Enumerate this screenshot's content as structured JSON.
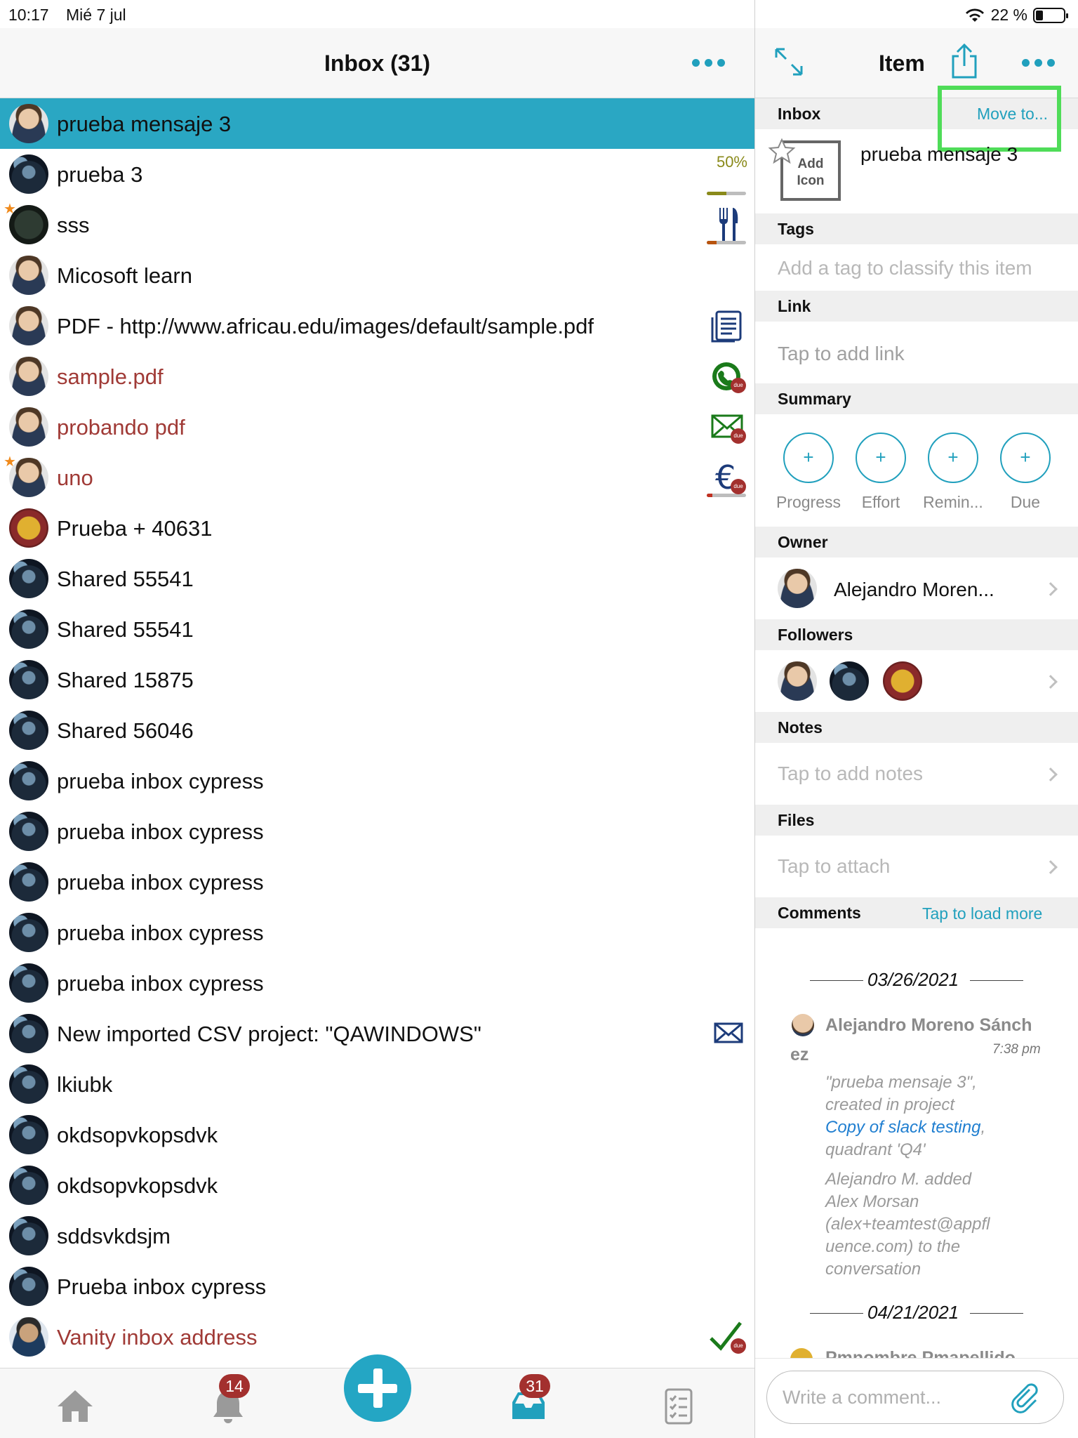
{
  "status": {
    "time": "10:17",
    "date": "Mié 7 jul",
    "battery": "22 %"
  },
  "list": {
    "title": "Inbox (31)",
    "rows": [
      {
        "text": "prueba mensaje 3",
        "avatar": "person",
        "selected": true
      },
      {
        "text": "prueba 3",
        "avatar": "dark",
        "progress": "50%"
      },
      {
        "text": "sss",
        "avatar": "dark2",
        "starred": true,
        "icon": "fork-knife-icon"
      },
      {
        "text": "Micosoft learn",
        "avatar": "person"
      },
      {
        "text": "PDF - http://www.africau.edu/images/default/sample.pdf",
        "avatar": "person",
        "icon": "document-icon"
      },
      {
        "text": "sample.pdf",
        "avatar": "person",
        "red": true,
        "icon": "globe-phone-icon",
        "due": "due"
      },
      {
        "text": "probando pdf",
        "avatar": "person",
        "red": true,
        "icon": "envelope-icon",
        "due": "due"
      },
      {
        "text": "uno",
        "avatar": "person",
        "red": true,
        "starred": true,
        "icon": "euro-icon",
        "due": "due"
      },
      {
        "text": "Prueba + 40631",
        "avatar": "crest"
      },
      {
        "text": "Shared 55541",
        "avatar": "dark"
      },
      {
        "text": "Shared 55541",
        "avatar": "dark"
      },
      {
        "text": "Shared 15875",
        "avatar": "dark"
      },
      {
        "text": "Shared 56046",
        "avatar": "dark"
      },
      {
        "text": "prueba inbox cypress",
        "avatar": "dark"
      },
      {
        "text": "prueba inbox cypress",
        "avatar": "dark"
      },
      {
        "text": "prueba inbox cypress",
        "avatar": "dark"
      },
      {
        "text": "prueba inbox cypress",
        "avatar": "dark"
      },
      {
        "text": "prueba inbox cypress",
        "avatar": "dark"
      },
      {
        "text": "New imported CSV project: \"QAWINDOWS\"",
        "avatar": "dark",
        "icon": "envelope-blue-icon"
      },
      {
        "text": "lkiubk",
        "avatar": "dark"
      },
      {
        "text": "okdsopvkopsdvk",
        "avatar": "dark"
      },
      {
        "text": "okdsopvkopsdvk",
        "avatar": "dark"
      },
      {
        "text": "sddsvkdsjm",
        "avatar": "dark"
      },
      {
        "text": "Prueba inbox cypress",
        "avatar": "dark"
      },
      {
        "text": "Vanity inbox address",
        "avatar": "vanity",
        "red": true,
        "icon": "checkmark-icon",
        "due": "due"
      }
    ]
  },
  "tabbar": {
    "notifications_badge": "14",
    "inbox_badge": "31"
  },
  "detail": {
    "title": "Item",
    "inbox_label": "Inbox",
    "move_to": "Move to...",
    "add_icon": "Add Icon",
    "item_title": "prueba mensaje 3",
    "tags_label": "Tags",
    "tags_placeholder": "Add a tag to classify this item",
    "link_label": "Link",
    "link_placeholder": "Tap to add link",
    "summary_label": "Summary",
    "summary_items": [
      {
        "plus": "+",
        "label": "Progress"
      },
      {
        "plus": "+",
        "label": "Effort"
      },
      {
        "plus": "+",
        "label": "Remin..."
      },
      {
        "plus": "+",
        "label": "Due"
      }
    ],
    "owner_label": "Owner",
    "owner_name": "Alejandro Moren...",
    "followers_label": "Followers",
    "notes_label": "Notes",
    "notes_placeholder": "Tap to add notes",
    "files_label": "Files",
    "files_placeholder": "Tap to attach",
    "comments_label": "Comments",
    "load_more": "Tap to load more",
    "date1": "03/26/2021",
    "comment_author": "Alejandro Moreno Sánch",
    "comment_author_wrap": "ez",
    "comment_time": "7:38 pm",
    "comment_l1": "\"prueba mensaje 3\",",
    "comment_l2": "created in project",
    "comment_link": "Copy of slack testing",
    "comment_l3": ",",
    "comment_l4": "quadrant 'Q4'",
    "comment_l5": "Alejandro M. added",
    "comment_l6": "Alex Morsan",
    "comment_l7": "(alex+teamtest@appfl",
    "comment_l8": "uence.com) to the",
    "comment_l9": "conversation",
    "date2": "04/21/2021",
    "partial_author": "Pmnombre Pmapellido",
    "compose_placeholder": "Write a comment..."
  }
}
